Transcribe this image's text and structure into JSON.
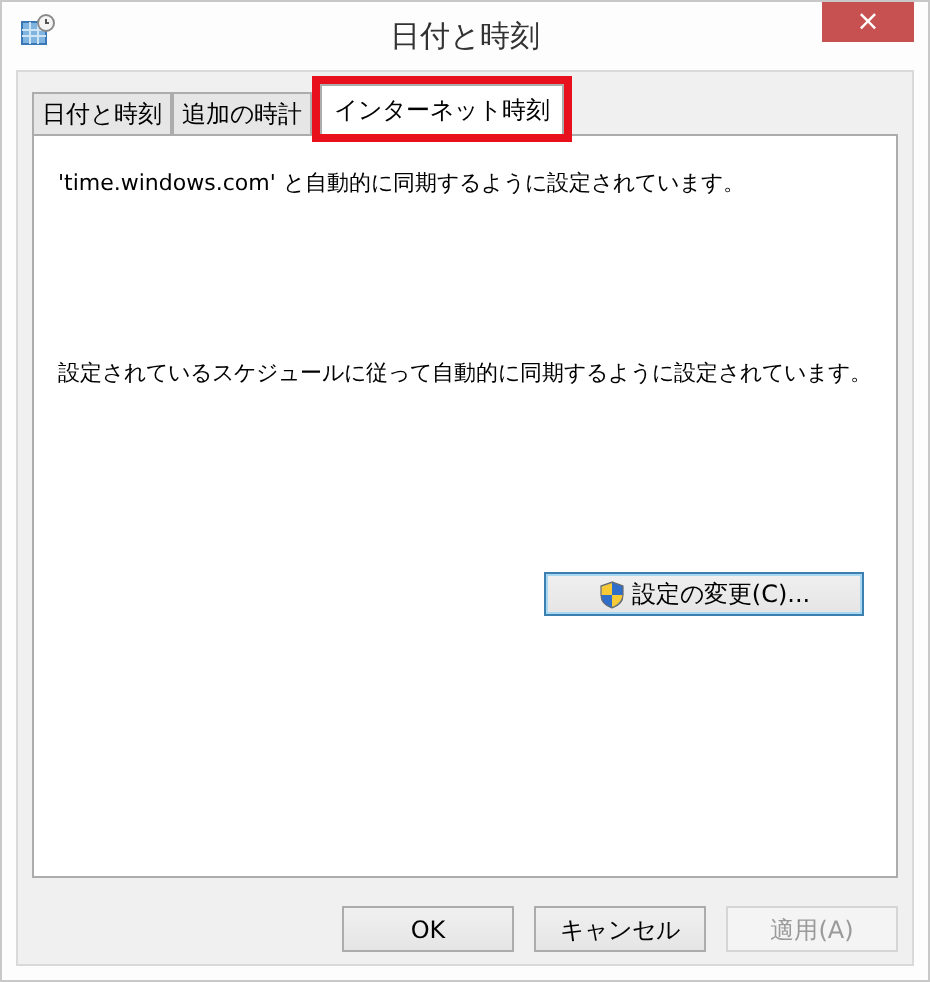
{
  "window": {
    "title": "日付と時刻",
    "close": "×"
  },
  "tabs": [
    {
      "label": "日付と時刻",
      "selected": false,
      "highlighted": false
    },
    {
      "label": "追加の時計",
      "selected": false,
      "highlighted": false
    },
    {
      "label": "インターネット時刻",
      "selected": true,
      "highlighted": true
    }
  ],
  "messages": [
    "'time.windows.com' と自動的に同期するように設定されています。",
    "設定されているスケジュールに従って自動的に同期するように設定されています。"
  ],
  "change_button": {
    "label": "設定の変更(C)...",
    "focused": true
  },
  "buttons": [
    {
      "label": "OK",
      "disabled": false
    },
    {
      "label": "キャンセル",
      "disabled": false
    },
    {
      "label": "適用(A)",
      "disabled": true
    }
  ]
}
